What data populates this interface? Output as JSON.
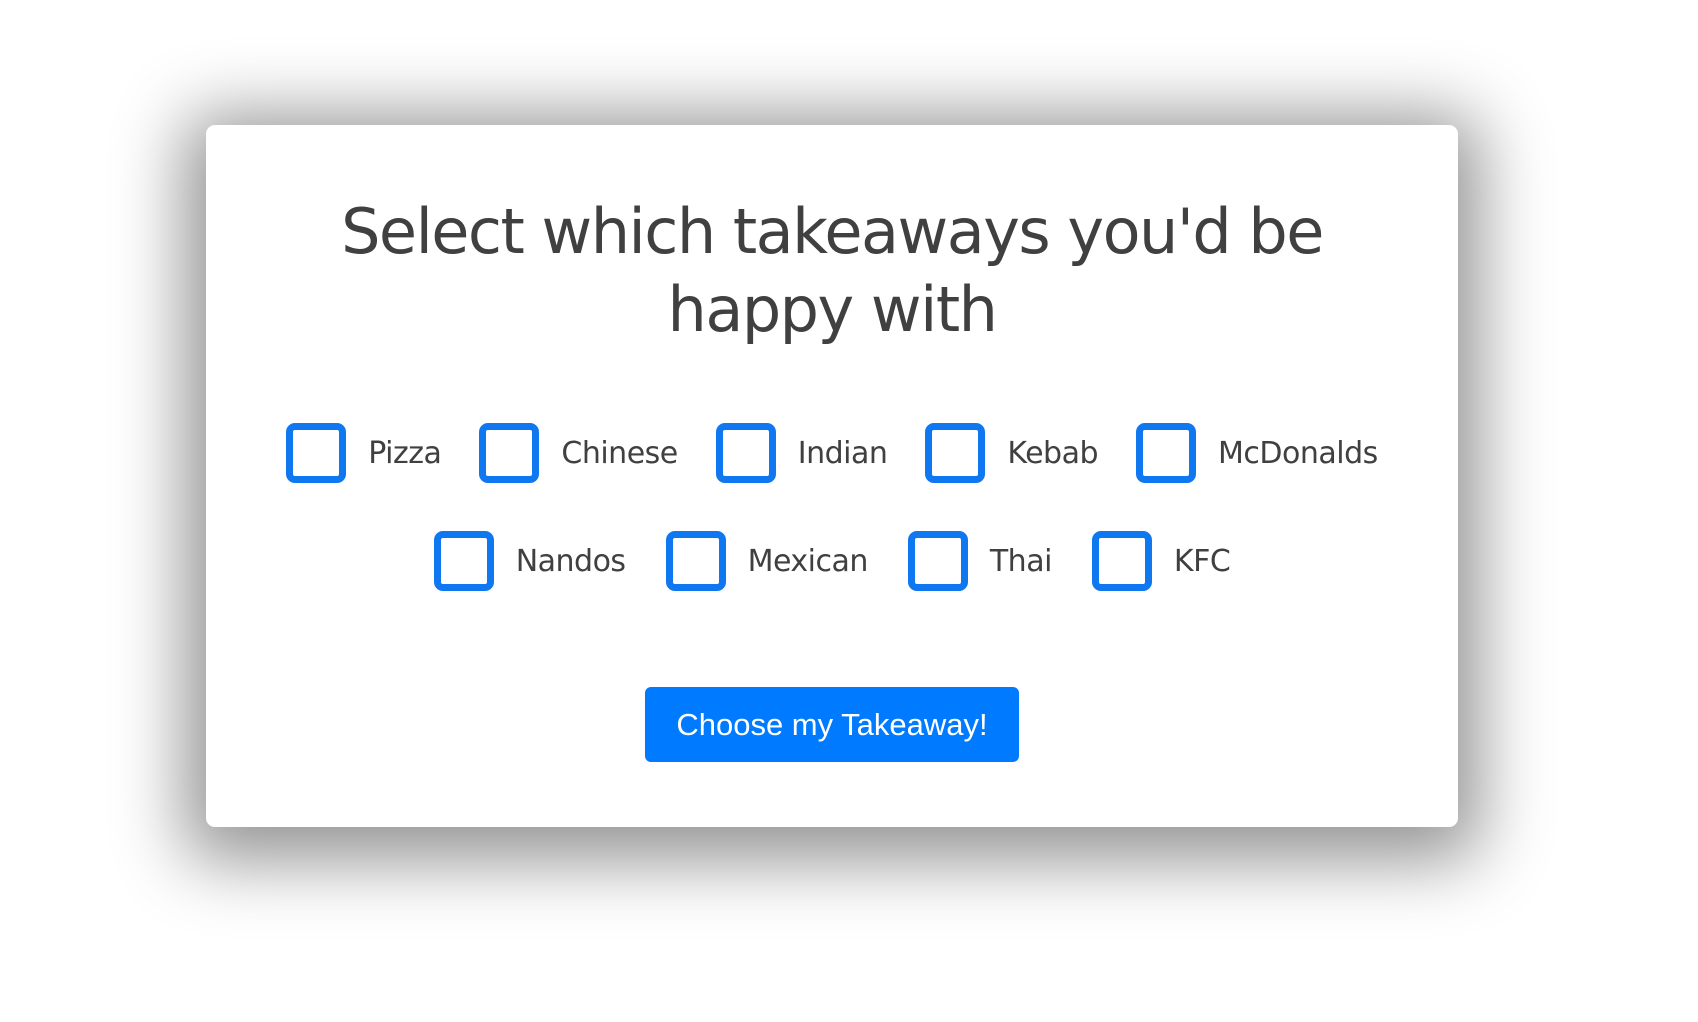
{
  "form": {
    "title": "Select which takeaways you'd be happy with",
    "options_row1": [
      {
        "label": "Pizza",
        "checked": false
      },
      {
        "label": "Chinese",
        "checked": false
      },
      {
        "label": "Indian",
        "checked": false
      },
      {
        "label": "Kebab",
        "checked": false
      },
      {
        "label": "McDonalds",
        "checked": false
      }
    ],
    "options_row2": [
      {
        "label": "Nandos",
        "checked": false
      },
      {
        "label": "Mexican",
        "checked": false
      },
      {
        "label": "Thai",
        "checked": false
      },
      {
        "label": "KFC",
        "checked": false
      }
    ],
    "submit_label": "Choose my Takeaway!"
  },
  "colors": {
    "accent": "#007bff",
    "checkbox_border": "#0f78f0",
    "text": "#404040"
  }
}
